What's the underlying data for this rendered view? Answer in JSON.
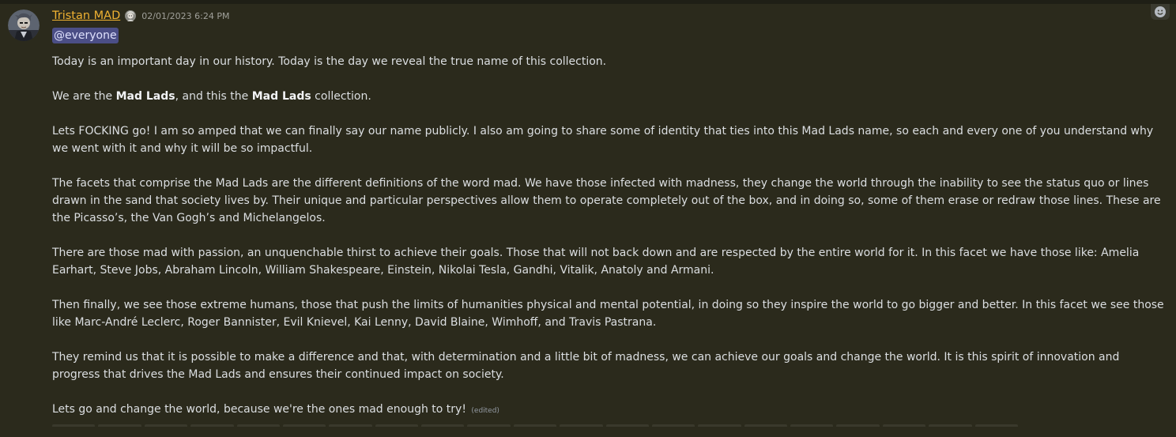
{
  "author": {
    "name": "Tristan MAD",
    "timestamp": "02/01/2023 6:24 PM"
  },
  "mention": "@everyone",
  "paragraphs": [
    {
      "parts": [
        {
          "t": "Today is an important day in our history. Today is the day we reveal the true name of this collection."
        }
      ]
    },
    {
      "parts": [
        {
          "t": "We are the "
        },
        {
          "t": "Mad Lads",
          "b": true
        },
        {
          "t": ", and this the "
        },
        {
          "t": "Mad Lads",
          "b": true
        },
        {
          "t": " collection."
        }
      ]
    },
    {
      "parts": [
        {
          "t": "Lets FOCKING go! I am so amped that we can finally say our name publicly. I also am going to share some of identity that ties into this Mad Lads name, so each and every one of you understand why we went with it and why it will be so impactful."
        }
      ]
    },
    {
      "parts": [
        {
          "t": "The facets that comprise the Mad Lads are the different definitions of the word mad. We have those infected with madness, they change the world through the inability to see the status quo or lines drawn in the sand that society lives by. Their unique and particular perspectives allow them to operate completely out of the box, and in doing so, some of them erase or redraw those lines. These are the Picasso’s, the Van Gogh’s and Michelangelos."
        }
      ]
    },
    {
      "parts": [
        {
          "t": "There are those mad with passion, an unquenchable thirst to achieve their goals. Those that will not back down and are respected by the entire world for it. In this facet we have those like: Amelia Earhart, Steve Jobs, Abraham Lincoln, William Shakespeare, Einstein, Nikolai Tesla, Gandhi, Vitalik, Anatoly and Armani."
        }
      ]
    },
    {
      "parts": [
        {
          "t": "Then finally, we see those extreme humans, those that push the limits of humanities physical and mental potential, in doing so they inspire the world to go bigger and better. In this facet we see those like Marc-André Leclerc, Roger Bannister, Evil Knievel, Kai Lenny, David Blaine, Wimhoff, and Travis Pastrana."
        }
      ]
    },
    {
      "parts": [
        {
          "t": "They remind us that it is possible to make a difference and that, with determination and a little bit of madness, we can achieve our goals and change the world. It is this spirit of innovation and progress that drives the Mad Lads and ensures their continued impact on society."
        }
      ]
    },
    {
      "parts": [
        {
          "t": "Lets go and change the world, because we're the ones mad enough to try!"
        }
      ]
    }
  ],
  "edited_label": "(edited)",
  "icons": {
    "avatar": "avatar-image",
    "role": "mad-lad-role-icon",
    "reaction": "add-reaction-icon"
  },
  "colors": {
    "background": "#2b2a1c",
    "username": "#f0b232",
    "mention_bg": "#4b4e86",
    "text": "#dbdee1"
  }
}
